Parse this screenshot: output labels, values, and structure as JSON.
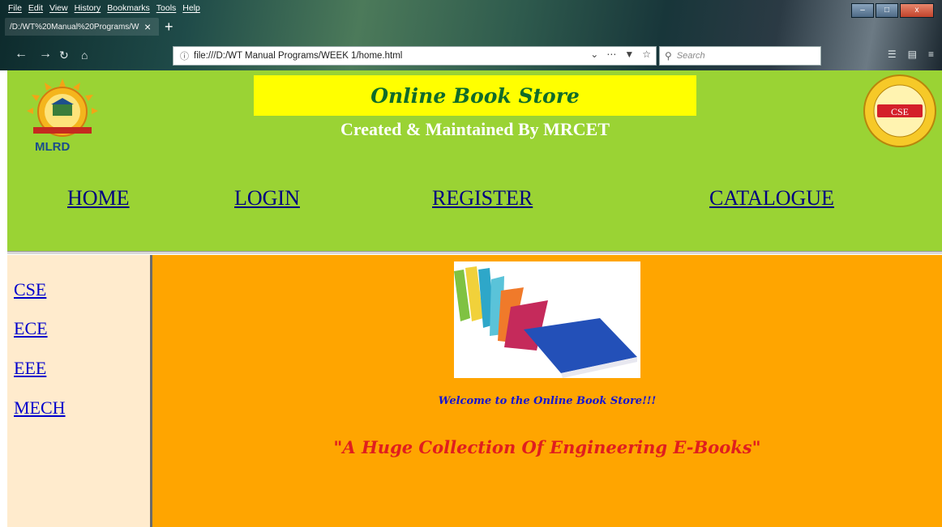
{
  "browser": {
    "menu": [
      "File",
      "Edit",
      "View",
      "History",
      "Bookmarks",
      "Tools",
      "Help"
    ],
    "tab_title": "/D:/WT%20Manual%20Programs/W",
    "tab_close": "×",
    "new_tab": "+",
    "url": "file:///D:/WT Manual Programs/WEEK 1/home.html",
    "search_placeholder": "Search",
    "window_buttons": {
      "minimize": "–",
      "maximize": "□",
      "close": "x"
    }
  },
  "header": {
    "logo_left_text": "MLRD",
    "title": "Online Book Store",
    "subtitle": "Created & Maintained By MRCET",
    "logo_right_text": "CSE",
    "nav": [
      "HOME",
      "LOGIN",
      "REGISTER",
      "CATALOGUE"
    ]
  },
  "sidebar": {
    "items": [
      "CSE",
      "ECE",
      "EEE",
      "MECH"
    ]
  },
  "main": {
    "welcome": "Welcome to the Online Book Store!!!",
    "tagline": "\"A Huge Collection Of Engineering E-Books\""
  },
  "colors": {
    "header_bg": "#9ad334",
    "title_bg": "#ffff00",
    "sidebar_bg": "#ffebcd",
    "main_bg": "#ffa500",
    "link": "#000080"
  }
}
